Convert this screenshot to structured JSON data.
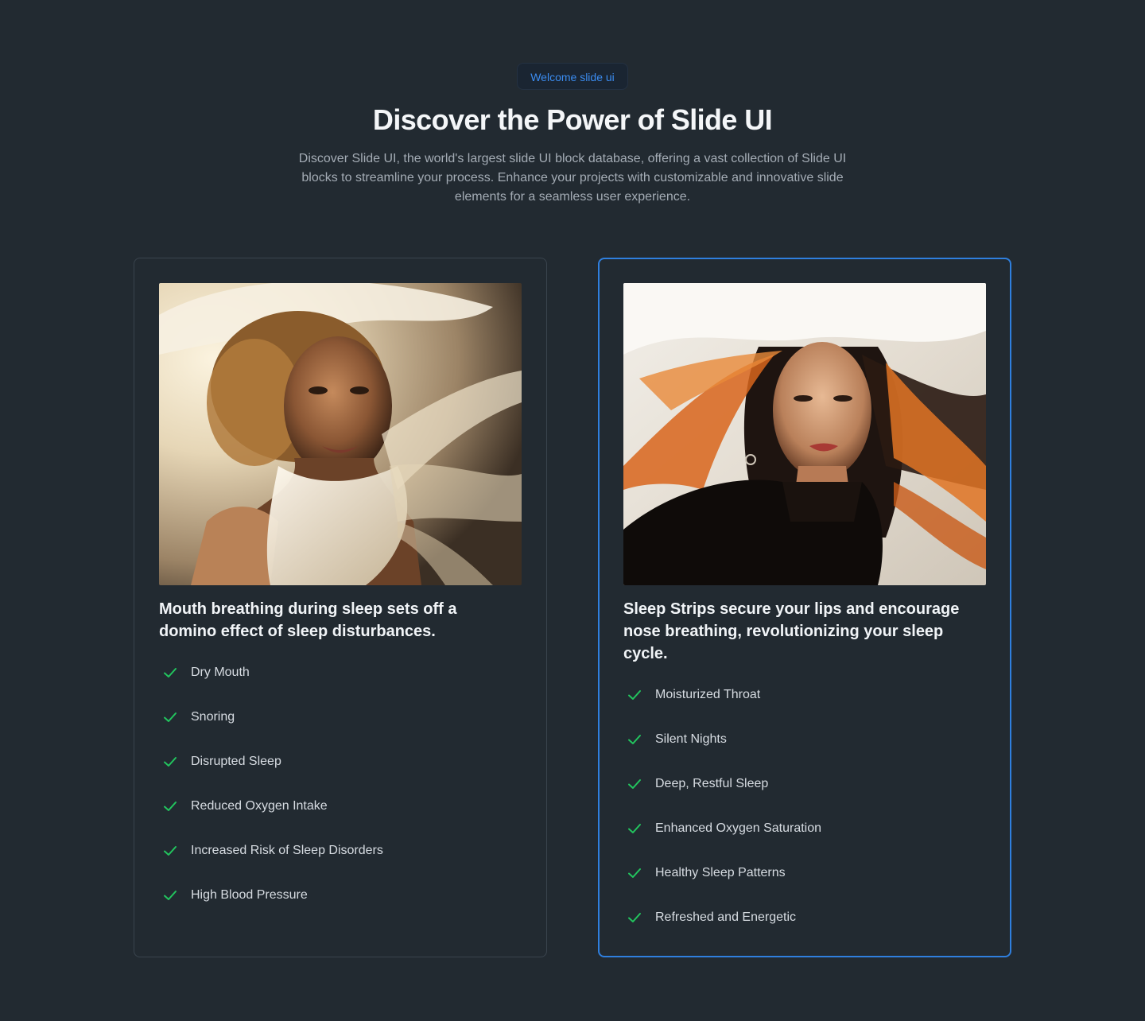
{
  "hero": {
    "badge": "Welcome slide ui",
    "title": "Discover the Power of Slide UI",
    "description": "Discover Slide UI, the world's largest slide UI block database, offering a vast collection of Slide UI blocks to streamline your process. Enhance your projects with customizable and innovative slide elements for a seamless user experience."
  },
  "cards": [
    {
      "heading": "Mouth breathing during sleep sets off a domino effect of sleep disturbances.",
      "image_alt": "Woman with curly hair and flowing white scarf",
      "features": [
        "Dry Mouth",
        "Snoring",
        "Disrupted Sleep",
        "Reduced Oxygen Intake",
        "Increased Risk of Sleep Disorders",
        "High Blood Pressure"
      ]
    },
    {
      "heading": "Sleep Strips secure your lips and encourage nose breathing, revolutionizing your sleep cycle.",
      "image_alt": "Woman with windblown hair and dark jacket",
      "features": [
        "Moisturized Throat",
        "Silent Nights",
        "Deep, Restful Sleep",
        "Enhanced Oxygen Saturation",
        "Healthy Sleep Patterns",
        "Refreshed and Energetic"
      ]
    }
  ],
  "colors": {
    "background": "#222a31",
    "accent": "#2f7fde",
    "check": "#22c55e"
  },
  "icons": {
    "feature": "check-icon"
  }
}
